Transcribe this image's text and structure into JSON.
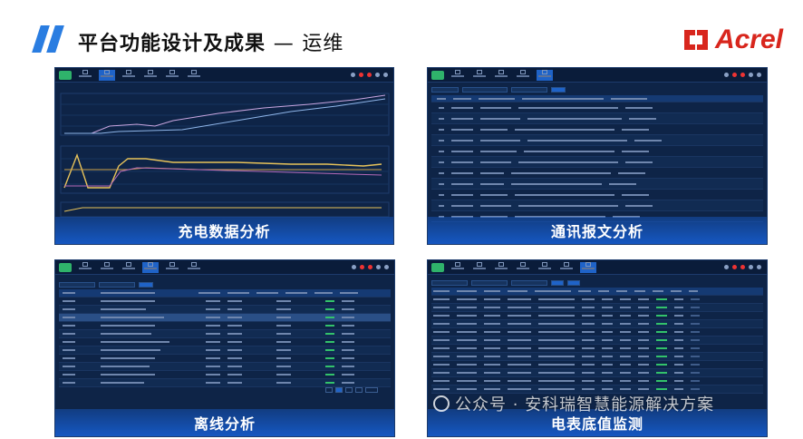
{
  "header": {
    "title": "平台功能设计及成果",
    "dash": "—",
    "subtitle": "运维",
    "brand": "Acrel",
    "brand_color": "#d8261d",
    "accent": "#2a7de1"
  },
  "panels": [
    {
      "caption": "充电数据分析"
    },
    {
      "caption": "通讯报文分析"
    },
    {
      "caption": "离线分析"
    },
    {
      "caption": "电表底值监测"
    }
  ],
  "watermark": {
    "text": "公众号 · 安科瑞智慧能源解决方案"
  }
}
